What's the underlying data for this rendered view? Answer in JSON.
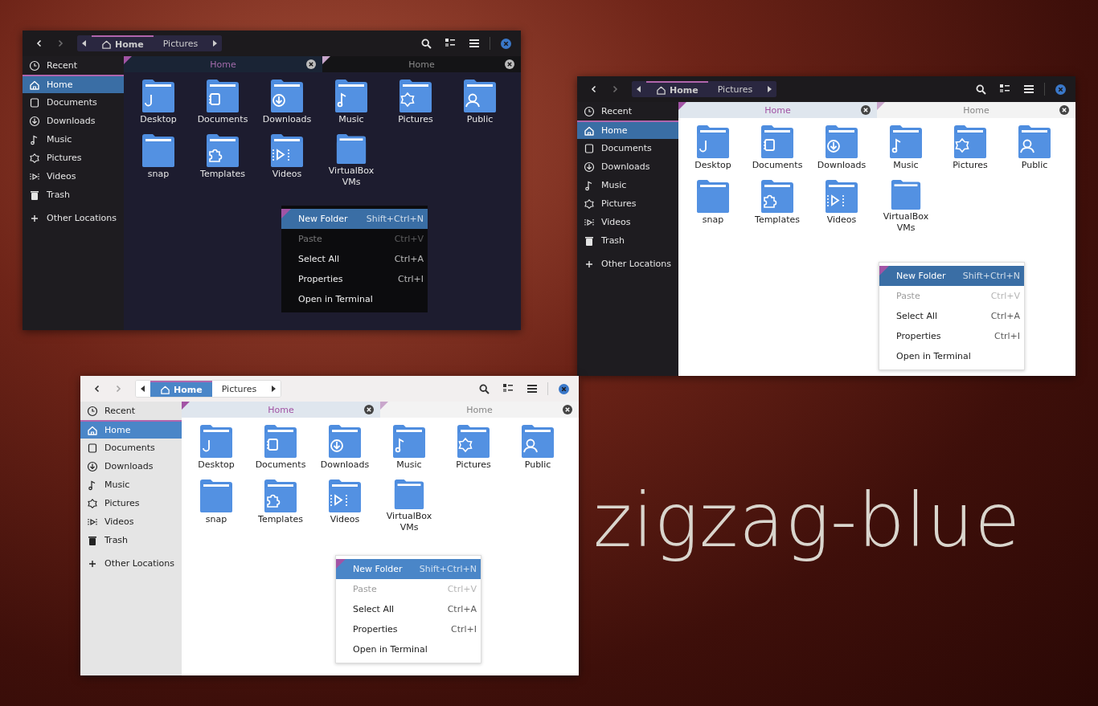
{
  "title": "zigzag-blue",
  "windows": [
    {
      "kind": "dark",
      "pathbar": [
        {
          "label": "Home",
          "selected": true
        },
        {
          "label": "Pictures",
          "selected": false
        }
      ],
      "sidebar": [
        {
          "label": "Recent",
          "kind": "recent",
          "selected": false
        },
        {
          "label": "Home",
          "kind": "home",
          "selected": true
        },
        {
          "label": "Documents",
          "kind": "documents",
          "selected": false
        },
        {
          "label": "Downloads",
          "kind": "downloads",
          "selected": false
        },
        {
          "label": "Music",
          "kind": "music",
          "selected": false
        },
        {
          "label": "Pictures",
          "kind": "pictures",
          "selected": false
        },
        {
          "label": "Videos",
          "kind": "videos",
          "selected": false
        },
        {
          "label": "Trash",
          "kind": "trash",
          "selected": false
        }
      ],
      "other_locations": "Other Locations",
      "tabs": [
        {
          "label": "Home",
          "selected": true
        },
        {
          "label": "Home",
          "selected": false
        }
      ],
      "folders": [
        {
          "label": "Desktop",
          "kind": "desktop"
        },
        {
          "label": "Documents",
          "kind": "documents"
        },
        {
          "label": "Downloads",
          "kind": "downloads"
        },
        {
          "label": "Music",
          "kind": "music"
        },
        {
          "label": "Pictures",
          "kind": "pictures"
        },
        {
          "label": "Public",
          "kind": "public"
        },
        {
          "label": "snap",
          "kind": "plain"
        },
        {
          "label": "Templates",
          "kind": "templates"
        },
        {
          "label": "Videos",
          "kind": "videos"
        },
        {
          "label": "VirtualBox VMs",
          "kind": "plain"
        }
      ],
      "context_menu": [
        {
          "label": "New Folder",
          "shortcut": "Shift+Ctrl+N",
          "selected": true,
          "disabled": false
        },
        {
          "label": "Paste",
          "shortcut": "Ctrl+V",
          "selected": false,
          "disabled": true
        },
        {
          "label": "Select All",
          "shortcut": "Ctrl+A",
          "selected": false,
          "disabled": false
        },
        {
          "label": "Properties",
          "shortcut": "Ctrl+I",
          "selected": false,
          "disabled": false
        },
        {
          "label": "Open in Terminal",
          "selected": false,
          "disabled": false
        }
      ]
    },
    {
      "kind": "mixed",
      "pathbar": [
        {
          "label": "Home",
          "selected": true
        },
        {
          "label": "Pictures",
          "selected": false
        }
      ],
      "sidebar": [
        {
          "label": "Recent",
          "kind": "recent",
          "selected": false
        },
        {
          "label": "Home",
          "kind": "home",
          "selected": true
        },
        {
          "label": "Documents",
          "kind": "documents",
          "selected": false
        },
        {
          "label": "Downloads",
          "kind": "downloads",
          "selected": false
        },
        {
          "label": "Music",
          "kind": "music",
          "selected": false
        },
        {
          "label": "Pictures",
          "kind": "pictures",
          "selected": false
        },
        {
          "label": "Videos",
          "kind": "videos",
          "selected": false
        },
        {
          "label": "Trash",
          "kind": "trash",
          "selected": false
        }
      ],
      "other_locations": "Other Locations",
      "tabs": [
        {
          "label": "Home",
          "selected": true
        },
        {
          "label": "Home",
          "selected": false
        }
      ],
      "folders": [
        {
          "label": "Desktop",
          "kind": "desktop"
        },
        {
          "label": "Documents",
          "kind": "documents"
        },
        {
          "label": "Downloads",
          "kind": "downloads"
        },
        {
          "label": "Music",
          "kind": "music"
        },
        {
          "label": "Pictures",
          "kind": "pictures"
        },
        {
          "label": "Public",
          "kind": "public"
        },
        {
          "label": "snap",
          "kind": "plain"
        },
        {
          "label": "Templates",
          "kind": "templates"
        },
        {
          "label": "Videos",
          "kind": "videos"
        },
        {
          "label": "VirtualBox VMs",
          "kind": "plain"
        }
      ],
      "context_menu": [
        {
          "label": "New Folder",
          "shortcut": "Shift+Ctrl+N",
          "selected": true,
          "disabled": false
        },
        {
          "label": "Paste",
          "shortcut": "Ctrl+V",
          "selected": false,
          "disabled": true
        },
        {
          "label": "Select All",
          "shortcut": "Ctrl+A",
          "selected": false,
          "disabled": false
        },
        {
          "label": "Properties",
          "shortcut": "Ctrl+I",
          "selected": false,
          "disabled": false
        },
        {
          "label": "Open in Terminal",
          "selected": false,
          "disabled": false
        }
      ]
    },
    {
      "kind": "light",
      "pathbar": [
        {
          "label": "Home",
          "selected": true
        },
        {
          "label": "Pictures",
          "selected": false
        }
      ],
      "sidebar": [
        {
          "label": "Recent",
          "kind": "recent",
          "selected": false
        },
        {
          "label": "Home",
          "kind": "home",
          "selected": true
        },
        {
          "label": "Documents",
          "kind": "documents",
          "selected": false
        },
        {
          "label": "Downloads",
          "kind": "downloads",
          "selected": false
        },
        {
          "label": "Music",
          "kind": "music",
          "selected": false
        },
        {
          "label": "Pictures",
          "kind": "pictures",
          "selected": false
        },
        {
          "label": "Videos",
          "kind": "videos",
          "selected": false
        },
        {
          "label": "Trash",
          "kind": "trash",
          "selected": false
        }
      ],
      "other_locations": "Other Locations",
      "tabs": [
        {
          "label": "Home",
          "selected": true
        },
        {
          "label": "Home",
          "selected": false
        }
      ],
      "folders": [
        {
          "label": "Desktop",
          "kind": "desktop"
        },
        {
          "label": "Documents",
          "kind": "documents"
        },
        {
          "label": "Downloads",
          "kind": "downloads"
        },
        {
          "label": "Music",
          "kind": "music"
        },
        {
          "label": "Pictures",
          "kind": "pictures"
        },
        {
          "label": "Public",
          "kind": "public"
        },
        {
          "label": "snap",
          "kind": "plain"
        },
        {
          "label": "Templates",
          "kind": "templates"
        },
        {
          "label": "Videos",
          "kind": "videos"
        },
        {
          "label": "VirtualBox VMs",
          "kind": "plain"
        }
      ],
      "context_menu": [
        {
          "label": "New Folder",
          "shortcut": "Shift+Ctrl+N",
          "selected": true,
          "disabled": false
        },
        {
          "label": "Paste",
          "shortcut": "Ctrl+V",
          "selected": false,
          "disabled": true
        },
        {
          "label": "Select All",
          "shortcut": "Ctrl+A",
          "selected": false,
          "disabled": false
        },
        {
          "label": "Properties",
          "shortcut": "Ctrl+I",
          "selected": false,
          "disabled": false
        },
        {
          "label": "Open in Terminal",
          "selected": false,
          "disabled": false
        }
      ]
    }
  ]
}
